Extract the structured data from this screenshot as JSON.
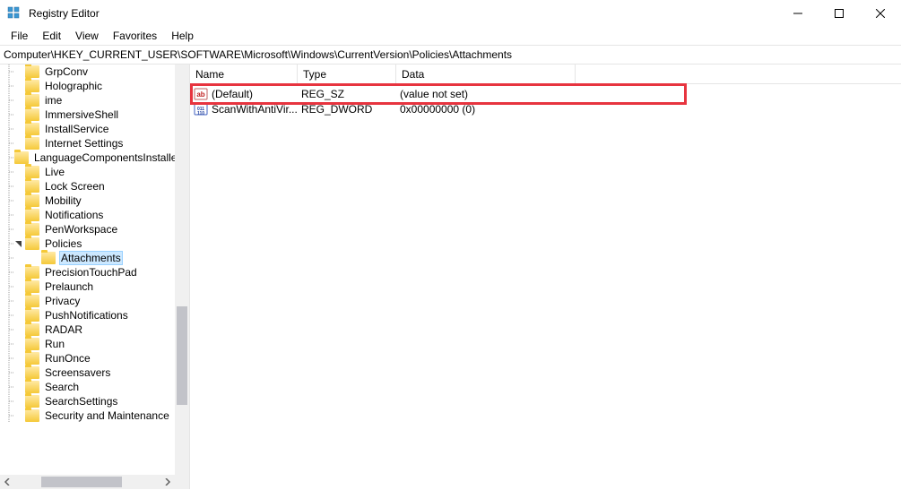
{
  "window": {
    "title": "Registry Editor"
  },
  "menu": {
    "file": "File",
    "edit": "Edit",
    "view": "View",
    "favorites": "Favorites",
    "help": "Help"
  },
  "address": "Computer\\HKEY_CURRENT_USER\\SOFTWARE\\Microsoft\\Windows\\CurrentVersion\\Policies\\Attachments",
  "tree": [
    {
      "indent": 0,
      "expander": "none",
      "label": "GrpConv"
    },
    {
      "indent": 0,
      "expander": "none",
      "label": "Holographic"
    },
    {
      "indent": 0,
      "expander": "none",
      "label": "ime"
    },
    {
      "indent": 0,
      "expander": "none",
      "label": "ImmersiveShell"
    },
    {
      "indent": 0,
      "expander": "none",
      "label": "InstallService"
    },
    {
      "indent": 0,
      "expander": "none",
      "label": "Internet Settings"
    },
    {
      "indent": 0,
      "expander": "none",
      "label": "LanguageComponentsInstaller"
    },
    {
      "indent": 0,
      "expander": "none",
      "label": "Live"
    },
    {
      "indent": 0,
      "expander": "none",
      "label": "Lock Screen"
    },
    {
      "indent": 0,
      "expander": "none",
      "label": "Mobility"
    },
    {
      "indent": 0,
      "expander": "none",
      "label": "Notifications"
    },
    {
      "indent": 0,
      "expander": "none",
      "label": "PenWorkspace"
    },
    {
      "indent": 0,
      "expander": "open",
      "label": "Policies"
    },
    {
      "indent": 1,
      "expander": "none",
      "label": "Attachments",
      "selected": true
    },
    {
      "indent": 0,
      "expander": "none",
      "label": "PrecisionTouchPad"
    },
    {
      "indent": 0,
      "expander": "none",
      "label": "Prelaunch"
    },
    {
      "indent": 0,
      "expander": "none",
      "label": "Privacy"
    },
    {
      "indent": 0,
      "expander": "none",
      "label": "PushNotifications"
    },
    {
      "indent": 0,
      "expander": "none",
      "label": "RADAR"
    },
    {
      "indent": 0,
      "expander": "none",
      "label": "Run"
    },
    {
      "indent": 0,
      "expander": "none",
      "label": "RunOnce"
    },
    {
      "indent": 0,
      "expander": "none",
      "label": "Screensavers"
    },
    {
      "indent": 0,
      "expander": "none",
      "label": "Search"
    },
    {
      "indent": 0,
      "expander": "none",
      "label": "SearchSettings"
    },
    {
      "indent": 0,
      "expander": "none",
      "label": "Security and Maintenance"
    }
  ],
  "columns": {
    "name": "Name",
    "type": "Type",
    "data": "Data"
  },
  "values": [
    {
      "icon": "string",
      "name": "(Default)",
      "type": "REG_SZ",
      "data": "(value not set)"
    },
    {
      "icon": "dword",
      "name": "ScanWithAntiVir...",
      "type": "REG_DWORD",
      "data": "0x00000000 (0)"
    }
  ]
}
